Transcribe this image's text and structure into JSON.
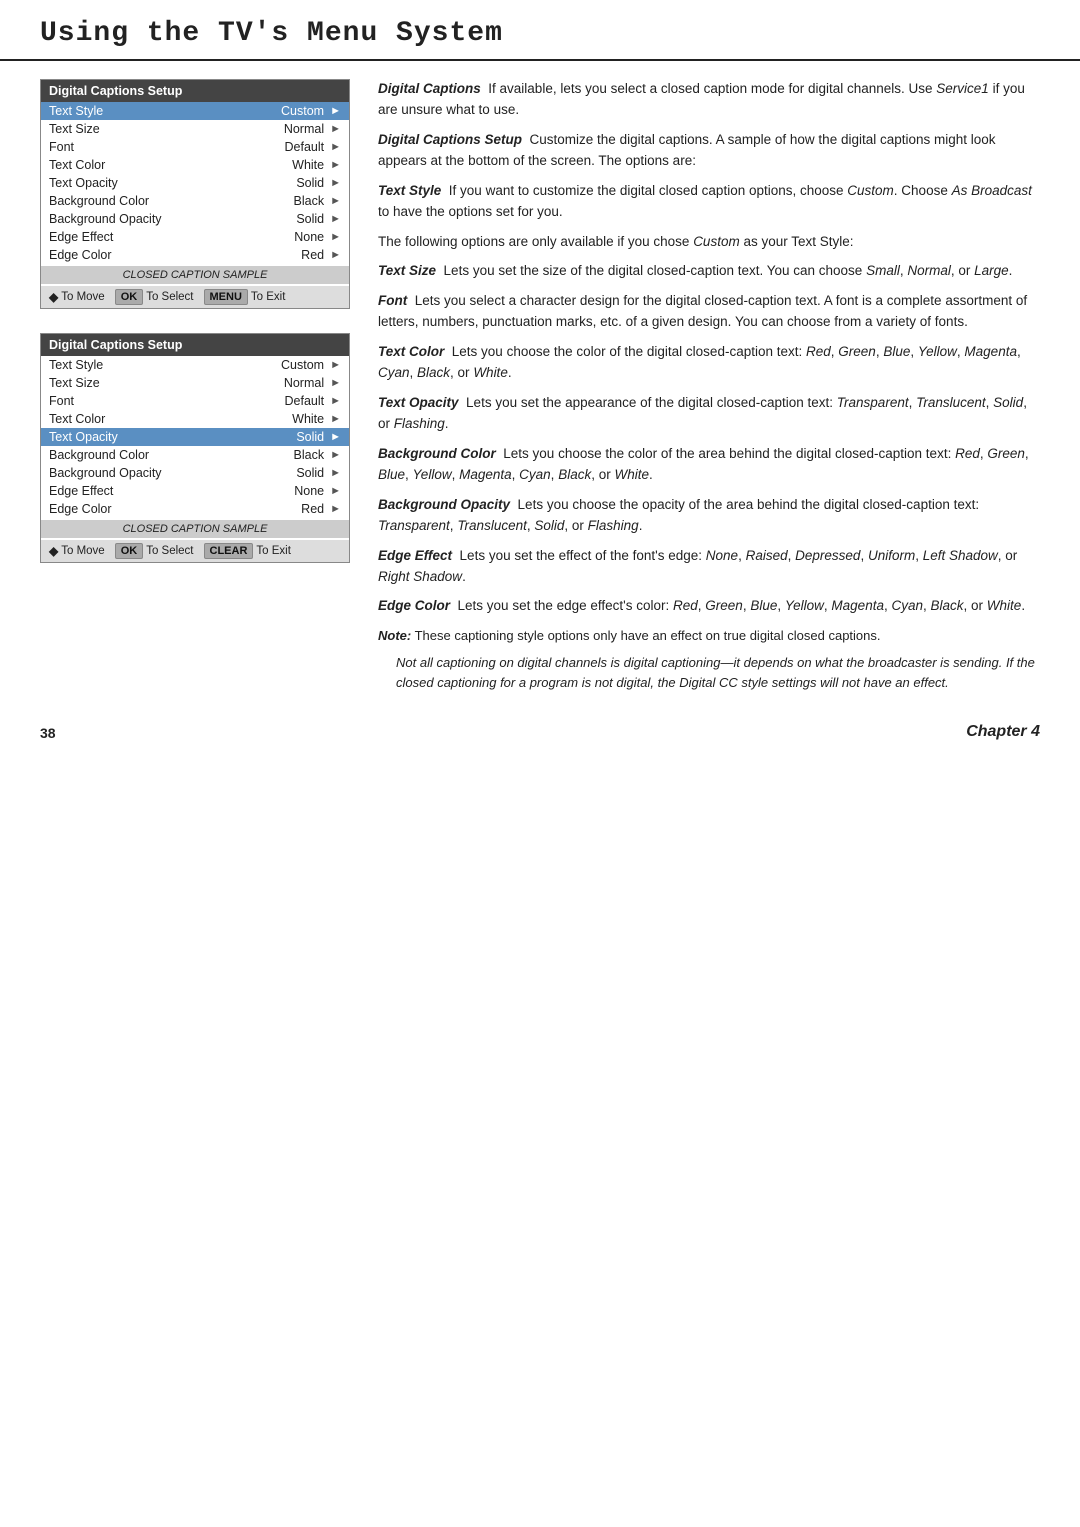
{
  "header": {
    "title": "Using the TV's Menu System"
  },
  "menu_top": {
    "title": "Digital Captions Setup",
    "rows": [
      {
        "label": "Text Style",
        "value": "Custom",
        "selected": true
      },
      {
        "label": "Text Size",
        "value": "Normal",
        "selected": false
      },
      {
        "label": "Font",
        "value": "Default",
        "selected": false
      },
      {
        "label": "Text Color",
        "value": "White",
        "selected": false
      },
      {
        "label": "Text Opacity",
        "value": "Solid",
        "selected": false
      },
      {
        "label": "Background Color",
        "value": "Black",
        "selected": false
      },
      {
        "label": "Background Opacity",
        "value": "Solid",
        "selected": false
      },
      {
        "label": "Edge Effect",
        "value": "None",
        "selected": false
      },
      {
        "label": "Edge Color",
        "value": "Red",
        "selected": false
      }
    ],
    "sample_label": "CLOSED CAPTION SAMPLE",
    "footer": [
      {
        "icon": "◆",
        "btn": null,
        "label": "To Move"
      },
      {
        "icon": null,
        "btn": "OK",
        "label": "To Select"
      },
      {
        "icon": null,
        "btn": "MENU",
        "label": "To Exit"
      }
    ]
  },
  "menu_bottom": {
    "title": "Digital Captions Setup",
    "rows": [
      {
        "label": "Text Style",
        "value": "Custom",
        "selected": false
      },
      {
        "label": "Text Size",
        "value": "Normal",
        "selected": false
      },
      {
        "label": "Font",
        "value": "Default",
        "selected": false
      },
      {
        "label": "Text Color",
        "value": "White",
        "selected": false
      },
      {
        "label": "Text Opacity",
        "value": "Solid",
        "selected": true
      },
      {
        "label": "Background Color",
        "value": "Black",
        "selected": false
      },
      {
        "label": "Background Opacity",
        "value": "Solid",
        "selected": false
      },
      {
        "label": "Edge Effect",
        "value": "None",
        "selected": false
      },
      {
        "label": "Edge Color",
        "value": "Red",
        "selected": false
      }
    ],
    "sample_label": "CLOSED CAPTION SAMPLE",
    "footer": [
      {
        "icon": "◆",
        "btn": null,
        "label": "To Move"
      },
      {
        "icon": null,
        "btn": "OK",
        "label": "To Select"
      },
      {
        "icon": null,
        "btn": "CLEAR",
        "label": "To Exit"
      }
    ]
  },
  "right_column": {
    "sections": [
      {
        "id": "digital-captions",
        "title": "Digital Captions",
        "body": "If available, lets you select a closed caption mode for digital channels. Use Service1 if you are unsure what to use."
      },
      {
        "id": "digital-captions-setup",
        "title": "Digital Captions Setup",
        "body": "Customize the digital captions. A sample of how the digital captions might look appears at the bottom of the screen. The options are:"
      },
      {
        "id": "text-style",
        "title": "Text Style",
        "body": "If you want to customize the digital closed caption options, choose Custom. Choose As Broadcast to have the options set for you."
      },
      {
        "id": "custom-note",
        "title": null,
        "body": "The following options are only available if you chose Custom as your Text Style:"
      },
      {
        "id": "text-size",
        "title": "Text Size",
        "body": "Lets you set the size of the digital closed-caption text. You can choose Small, Normal, or Large."
      },
      {
        "id": "font",
        "title": "Font",
        "body": "Lets you select a character design for the digital closed-caption text. A font is a complete assortment of letters, numbers, punctuation marks, etc. of a given design. You can choose from a variety of fonts."
      },
      {
        "id": "text-color",
        "title": "Text Color",
        "body": "Lets you choose the color of the digital closed-caption text: Red, Green, Blue, Yellow, Magenta, Cyan, Black, or White."
      },
      {
        "id": "text-opacity",
        "title": "Text Opacity",
        "body": "Lets you set the appearance of the digital closed-caption text: Transparent, Translucent, Solid, or Flashing."
      },
      {
        "id": "background-color",
        "title": "Background Color",
        "body": "Lets you choose the color of the area behind the digital closed-caption text: Red, Green, Blue, Yellow, Magenta, Cyan, Black, or White."
      },
      {
        "id": "background-opacity",
        "title": "Background Opacity",
        "body": "Lets you choose the opacity of the area behind the digital closed-caption text: Transparent, Translucent, Solid, or Flashing."
      },
      {
        "id": "edge-effect",
        "title": "Edge Effect",
        "body": "Lets you set the effect of the font's edge: None, Raised, Depressed, Uniform, Left Shadow, or Right Shadow."
      },
      {
        "id": "edge-color",
        "title": "Edge Color",
        "body": "Lets you set the edge effect's color: Red, Green, Blue, Yellow, Magenta, Cyan, Black, or White."
      },
      {
        "id": "note",
        "title": "Note:",
        "body": "These captioning style options only have an effect on true digital closed captions.",
        "indent": "Not all captioning on digital channels is digital captioning—it depends on what the broadcaster is sending. If the closed captioning for a program is not digital, the Digital CC style settings will not have an effect."
      }
    ]
  },
  "footer": {
    "page_number": "38",
    "chapter_label": "Chapter 4"
  }
}
